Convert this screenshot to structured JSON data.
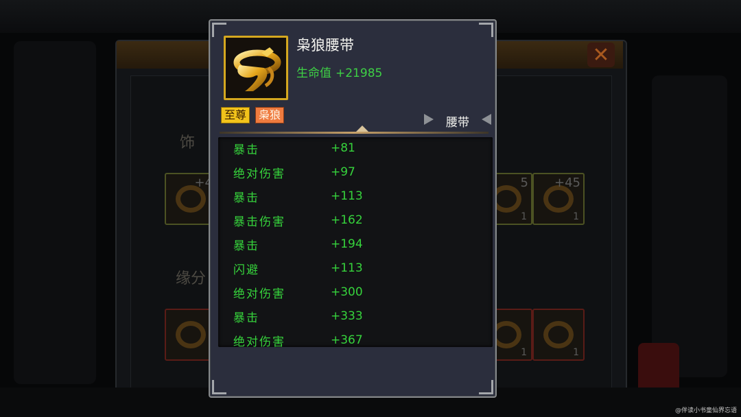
{
  "background": {
    "section_label_1": "饰",
    "section_label_2": "缘分",
    "slots": [
      {
        "level": "+4",
        "count": ""
      },
      {
        "level": "5",
        "count": "1"
      },
      {
        "level": "+45",
        "count": "1"
      },
      {
        "level": "",
        "count": ""
      },
      {
        "level": "",
        "count": "1"
      },
      {
        "level": "",
        "count": "1"
      }
    ]
  },
  "tooltip": {
    "item_name": "枭狼腰带",
    "main_stat": {
      "name": "生命值",
      "value": "+21985"
    },
    "tags": {
      "rarity": "至尊",
      "set": "枭狼"
    },
    "item_type": "腰带",
    "icon": "golden-belt-icon",
    "frame_color": "#d5a81f",
    "stat_color": "#36d33c",
    "stats": [
      {
        "name": "暴击",
        "value": "+81"
      },
      {
        "name": "绝对伤害",
        "value": "+97"
      },
      {
        "name": "暴击",
        "value": "+113"
      },
      {
        "name": "暴击伤害",
        "value": "+162"
      },
      {
        "name": "暴击",
        "value": "+194"
      },
      {
        "name": "闪避",
        "value": "+113"
      },
      {
        "name": "绝对伤害",
        "value": "+300"
      },
      {
        "name": "暴击",
        "value": "+333"
      },
      {
        "name": "绝对伤害",
        "value": "+367"
      }
    ]
  },
  "watermark": "@伴读小书童仙界忘语"
}
